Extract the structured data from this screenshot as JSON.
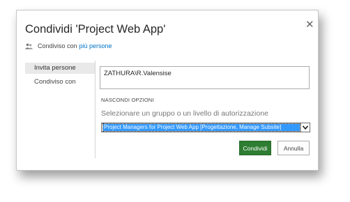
{
  "dialog": {
    "title": "Condividi 'Project Web App'",
    "close_icon": "close-icon",
    "shared_with_prefix": "Condiviso con",
    "shared_with_link": "più persone"
  },
  "nav": {
    "items": [
      {
        "label": "Invita persone",
        "active": true
      },
      {
        "label": "Condiviso con",
        "active": false
      }
    ]
  },
  "invite": {
    "people_value": "ZATHURA\\R.Valensise",
    "hide_options_label": "NASCONDI OPZIONI",
    "group_label": "Selezionare un gruppo o un livello di autorizzazione",
    "group_selected": "Project Managers for Project Web App [Progettazione, Manage Subsite]"
  },
  "buttons": {
    "share_label": "Condividi",
    "cancel_label": "Annulla"
  },
  "colors": {
    "accent": "#2e7d32",
    "link": "#0072c6",
    "selection": "#3399ff"
  }
}
